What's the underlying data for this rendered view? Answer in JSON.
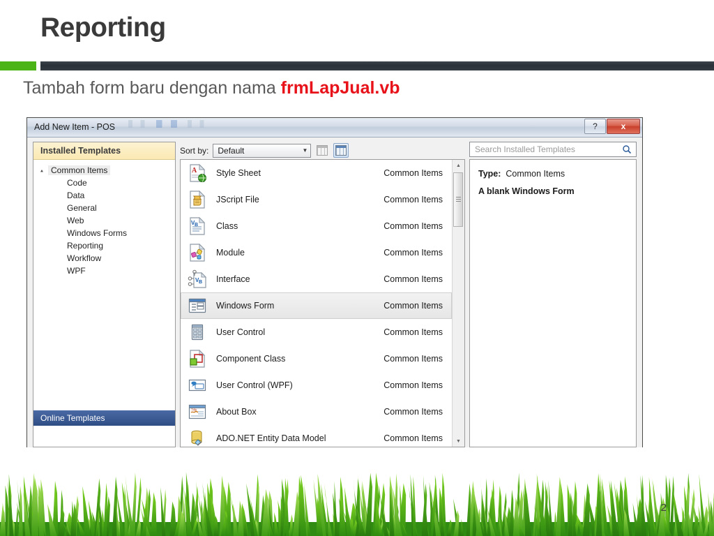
{
  "slide": {
    "title": "Reporting",
    "subtitle_prefix": "Tambah form baru dengan nama ",
    "subtitle_accent": "frmLapJual.vb",
    "page_number": "2",
    "accent_green": "#4cb416",
    "accent_red": "#e8121b",
    "rule_dark": "#2b3138"
  },
  "dialog": {
    "title": "Add New Item - POS",
    "help_button": "?",
    "close_button": "x",
    "left_pane": {
      "header": "Installed Templates",
      "tree": [
        {
          "label": "Common Items",
          "level": "root",
          "expander": "▴"
        },
        {
          "label": "Code",
          "level": "child",
          "expander": ""
        },
        {
          "label": "Data",
          "level": "child",
          "expander": ""
        },
        {
          "label": "General",
          "level": "child",
          "expander": ""
        },
        {
          "label": "Web",
          "level": "child",
          "expander": ""
        },
        {
          "label": "Windows Forms",
          "level": "child",
          "expander": ""
        },
        {
          "label": "Reporting",
          "level": "child",
          "expander": ""
        },
        {
          "label": "Workflow",
          "level": "child",
          "expander": ""
        },
        {
          "label": "WPF",
          "level": "child",
          "expander": ""
        }
      ],
      "online_templates": "Online Templates"
    },
    "toolbar": {
      "sort_label": "Sort by:",
      "sort_value": "Default",
      "sort_arrow": "▼",
      "view_small_icon": "small-icons-view-icon",
      "view_large_icon": "large-icons-view-icon"
    },
    "list": {
      "items": [
        {
          "name": "Style Sheet",
          "category": "Common Items",
          "icon": "style-sheet-icon",
          "selected": false
        },
        {
          "name": "JScript File",
          "category": "Common Items",
          "icon": "jscript-file-icon",
          "selected": false
        },
        {
          "name": "Class",
          "category": "Common Items",
          "icon": "class-icon",
          "selected": false
        },
        {
          "name": "Module",
          "category": "Common Items",
          "icon": "module-icon",
          "selected": false
        },
        {
          "name": "Interface",
          "category": "Common Items",
          "icon": "interface-icon",
          "selected": false
        },
        {
          "name": "Windows Form",
          "category": "Common Items",
          "icon": "windows-form-icon",
          "selected": true
        },
        {
          "name": "User Control",
          "category": "Common Items",
          "icon": "user-control-icon",
          "selected": false
        },
        {
          "name": "Component Class",
          "category": "Common Items",
          "icon": "component-class-icon",
          "selected": false
        },
        {
          "name": "User Control (WPF)",
          "category": "Common Items",
          "icon": "user-control-wpf-icon",
          "selected": false
        },
        {
          "name": "About Box",
          "category": "Common Items",
          "icon": "about-box-icon",
          "selected": false
        },
        {
          "name": "ADO.NET Entity Data Model",
          "category": "Common Items",
          "icon": "ado-net-entity-data-model-icon",
          "selected": false
        }
      ],
      "scroll_up": "▲",
      "scroll_down": "▼"
    },
    "right_pane": {
      "search_placeholder": "Search Installed Templates",
      "search_value": "",
      "search_icon": "search-icon",
      "type_label": "Type:",
      "type_value": "Common Items",
      "description": "A blank Windows Form"
    }
  }
}
